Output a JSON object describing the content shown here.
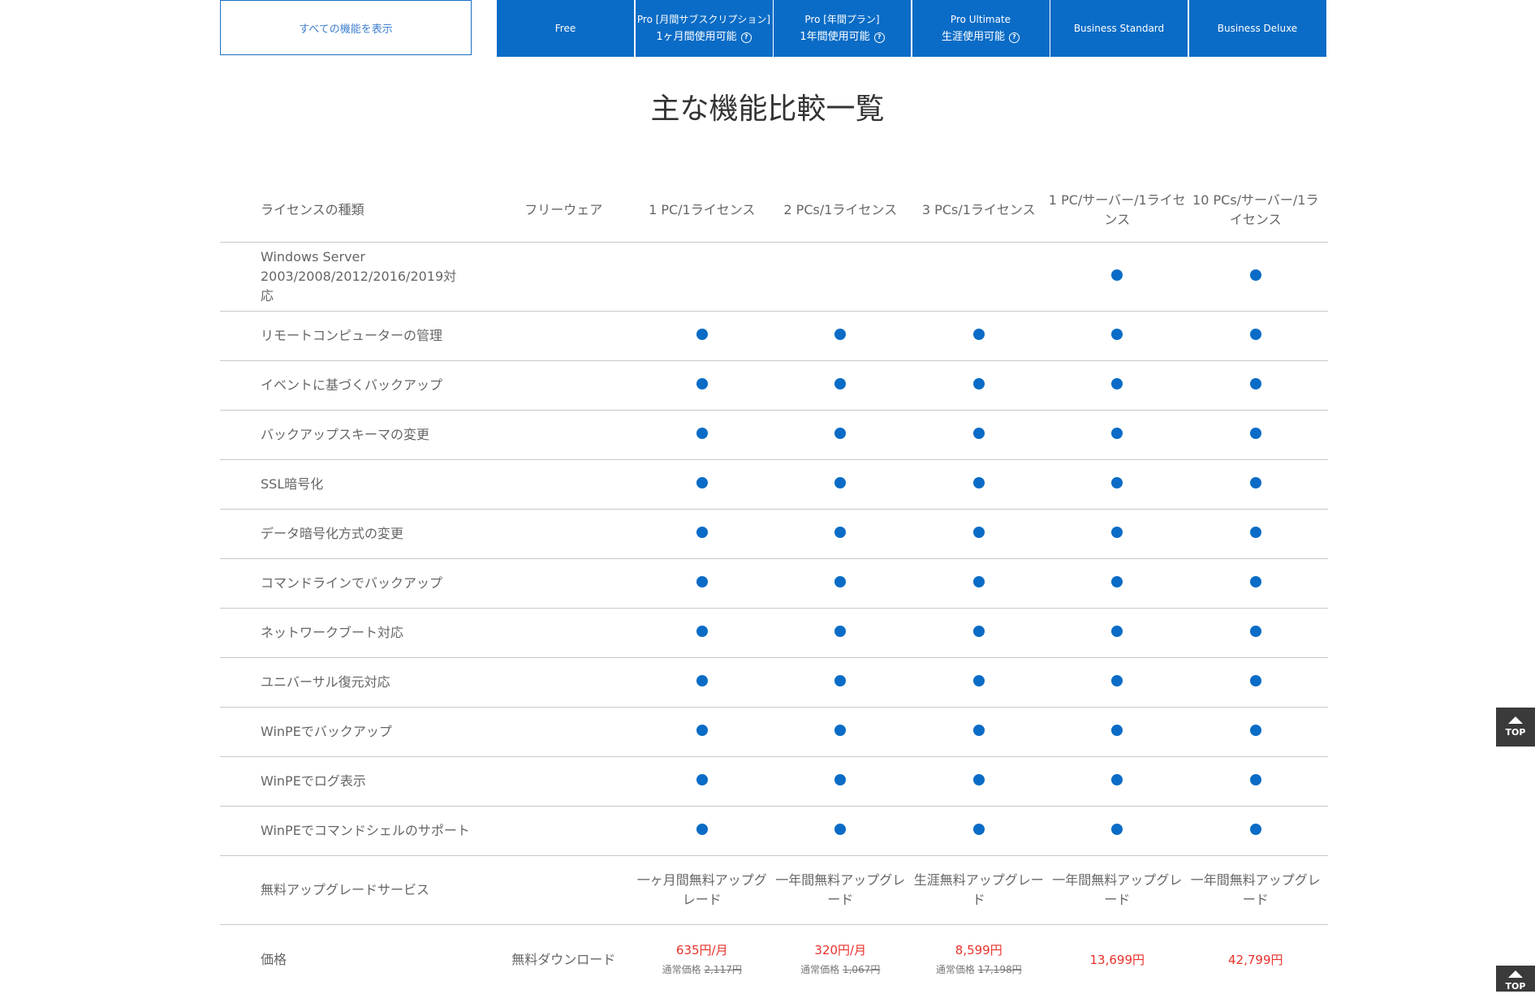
{
  "header": {
    "show_all": "すべての機能を表示",
    "plans": [
      {
        "line1": "Free",
        "line2": "",
        "help": false
      },
      {
        "line1": "Pro [月間サブスクリプション]",
        "line2": "1ヶ月間使用可能",
        "help": true
      },
      {
        "line1": "Pro [年間プラン]",
        "line2": "1年間使用可能",
        "help": true
      },
      {
        "line1": "Pro Ultimate",
        "line2": "生涯使用可能",
        "help": true
      },
      {
        "line1": "Business Standard",
        "line2": "",
        "help": false
      },
      {
        "line1": "Business Deluxe",
        "line2": "",
        "help": false
      }
    ]
  },
  "title": "主な機能比較一覧",
  "license": {
    "label": "ライセンスの種類",
    "values": [
      "フリーウェア",
      "1 PC/1ライセンス",
      "2 PCs/1ライセンス",
      "3 PCs/1ライセンス",
      "1 PC/サーバー/1ライセンス",
      "10 PCs/サーバー/1ライセンス"
    ]
  },
  "features": [
    {
      "label": "Windows Server 2003/2008/2012/2016/2019対応",
      "support": [
        false,
        false,
        false,
        false,
        true,
        true
      ]
    },
    {
      "label": "リモートコンピューターの管理",
      "support": [
        false,
        true,
        true,
        true,
        true,
        true
      ]
    },
    {
      "label": "イベントに基づくバックアップ",
      "support": [
        false,
        true,
        true,
        true,
        true,
        true
      ]
    },
    {
      "label": "バックアップスキーマの変更",
      "support": [
        false,
        true,
        true,
        true,
        true,
        true
      ]
    },
    {
      "label": "SSL暗号化",
      "support": [
        false,
        true,
        true,
        true,
        true,
        true
      ]
    },
    {
      "label": "データ暗号化方式の変更",
      "support": [
        false,
        true,
        true,
        true,
        true,
        true
      ]
    },
    {
      "label": "コマンドラインでバックアップ",
      "support": [
        false,
        true,
        true,
        true,
        true,
        true
      ]
    },
    {
      "label": "ネットワークブート対応",
      "support": [
        false,
        true,
        true,
        true,
        true,
        true
      ]
    },
    {
      "label": "ユニバーサル復元対応",
      "support": [
        false,
        true,
        true,
        true,
        true,
        true
      ]
    },
    {
      "label": "WinPEでバックアップ",
      "support": [
        false,
        true,
        true,
        true,
        true,
        true
      ]
    },
    {
      "label": "WinPEでログ表示",
      "support": [
        false,
        true,
        true,
        true,
        true,
        true
      ]
    },
    {
      "label": "WinPEでコマンドシェルのサポート",
      "support": [
        false,
        true,
        true,
        true,
        true,
        true
      ]
    }
  ],
  "upgrade": {
    "label": "無料アップグレードサービス",
    "values": [
      "",
      "一ヶ月間無料アップグレード",
      "一年間無料アップグレード",
      "生涯無料アップグレード",
      "一年間無料アップグレード",
      "一年間無料アップグレード"
    ]
  },
  "price": {
    "label": "価格",
    "free": "無料ダウンロード",
    "regular_label": "通常価格",
    "values": [
      {
        "price": "635円/月",
        "regular": "2,117円"
      },
      {
        "price": "320円/月",
        "regular": "1,067円"
      },
      {
        "price": "8,599円",
        "regular": "17,198円"
      },
      {
        "price": "13,699円",
        "regular": ""
      },
      {
        "price": "42,799円",
        "regular": ""
      }
    ]
  },
  "top_button": "TOP",
  "colors": {
    "accent": "#0a6cc6",
    "price": "#e8322a"
  }
}
